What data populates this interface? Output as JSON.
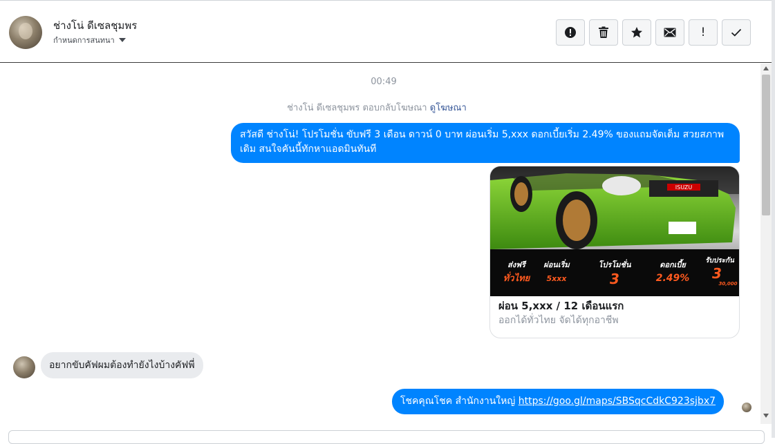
{
  "header": {
    "contact_name": "ช่างโน่ ดีเซลชุมพร",
    "assign_label": "กำหนดการสนทนา",
    "toolbar": [
      "alert-circle-icon",
      "trash-icon",
      "star-icon",
      "mail-icon",
      "exclamation-icon",
      "check-icon"
    ]
  },
  "conversation": {
    "timestamp": "00:49",
    "ad_reply_text": "ช่างโน่ ดีเซลชุมพร ตอบกลับโฆษณา",
    "ad_reply_link": "ดูโฆษณา",
    "messages": [
      {
        "direction": "outgoing",
        "text": "สวัสดี ช่างโน่! โปรโมชั่น ขับฟรี 3 เดือน ดาวน์ 0 บาท ผ่อนเริ่ม 5,xxx  ดอกเบี้ยเริ่ม 2.49% ของแถมจัดเต็ม สวยสภาพเดิม สนใจคันนี้ทักหาแอดมินทันที"
      },
      {
        "direction": "outgoing",
        "type": "ad_card",
        "title": "ผ่อน 5,xxx / 12 เดือนแรก",
        "subtitle": "ออกได้ทั่วไทย จัดได้ทุกอาชีพ",
        "image": {
          "brand": "ISUZU",
          "promos": [
            {
              "label": "ส่งฟรี",
              "value": "ทั่วไทย"
            },
            {
              "label": "ผ่อนเริ่ม",
              "value": "5xxx"
            },
            {
              "label": "โปรโมชั่น",
              "value": "3"
            },
            {
              "label": "ดอกเบี้ย",
              "value": "2.49%"
            },
            {
              "label": "รับประกัน",
              "value": "3"
            }
          ],
          "warranty_note": "30,000"
        }
      },
      {
        "direction": "incoming",
        "text": "อยากขับคัฟผมต้องทำยังไงบ้างคัฟพี่"
      },
      {
        "direction": "outgoing",
        "text": "โชคคุณโชค สำนักงานใหญ่",
        "link": "https://goo.gl/maps/SBSqcCdkC923sjbx7"
      }
    ]
  },
  "colors": {
    "outgoing_bubble": "#0084ff",
    "incoming_bubble": "#e9ebee",
    "link": "#385898",
    "car_green": "#6cc020",
    "promo_orange": "#ff5a1f"
  }
}
